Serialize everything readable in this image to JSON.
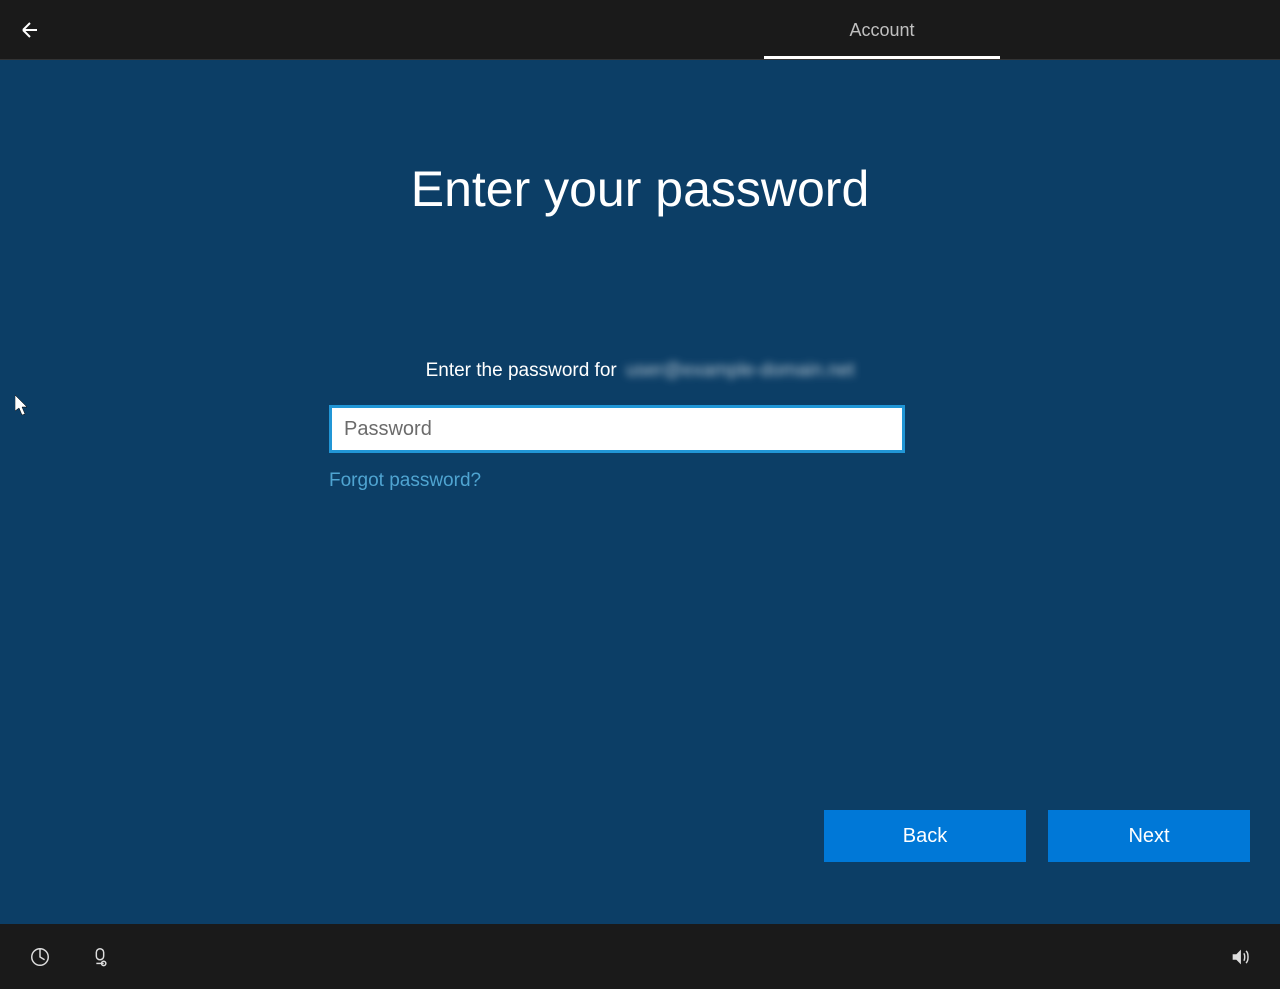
{
  "header": {
    "tab_label": "Account"
  },
  "main": {
    "title": "Enter your password",
    "prompt": "Enter the password for",
    "email_blurred": "user@example-domain.net",
    "password_placeholder": "Password",
    "password_value": "",
    "forgot_link": "Forgot password?"
  },
  "buttons": {
    "back": "Back",
    "next": "Next"
  },
  "colors": {
    "background": "#0c3e66",
    "header": "#1a1a1a",
    "accent": "#0078d7",
    "input_border": "#2196d6",
    "link": "#4fa4d1"
  }
}
